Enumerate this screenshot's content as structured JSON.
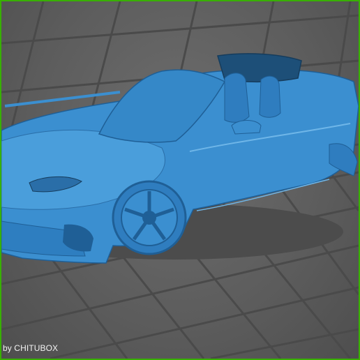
{
  "viewport": {
    "watermark_text": "by CHITUBOX",
    "model_icon": "car-model-icon",
    "colors": {
      "model_fill": "#3b8fd0",
      "model_dark": "#1f5f96",
      "model_highlight": "#6fb6e8",
      "grid_line": "#4a4a4a",
      "grid_fill": "#5e5e5e",
      "frame_border": "#38b000"
    }
  }
}
